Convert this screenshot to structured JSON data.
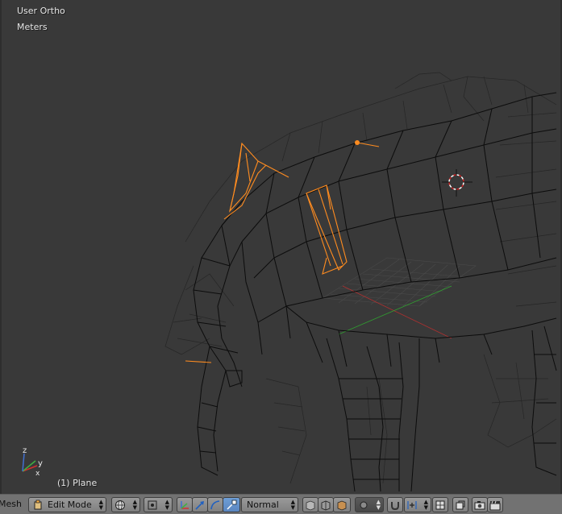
{
  "viewport": {
    "view_name": "User Ortho",
    "units": "Meters",
    "object_info": "(1) Plane",
    "axis_labels": {
      "x": "x",
      "y": "y",
      "z": "z"
    }
  },
  "header": {
    "menu_mesh": "Mesh",
    "mode": "Edit Mode",
    "pivot_icon": "pivot-icon",
    "orientation": "Normal"
  },
  "colors": {
    "background": "#393939",
    "wire": "#101010",
    "selected": "#ff8c20",
    "axis_x": "#d03030",
    "axis_y": "#40b040",
    "axis_z": "#4070d0",
    "header": "#727272"
  }
}
